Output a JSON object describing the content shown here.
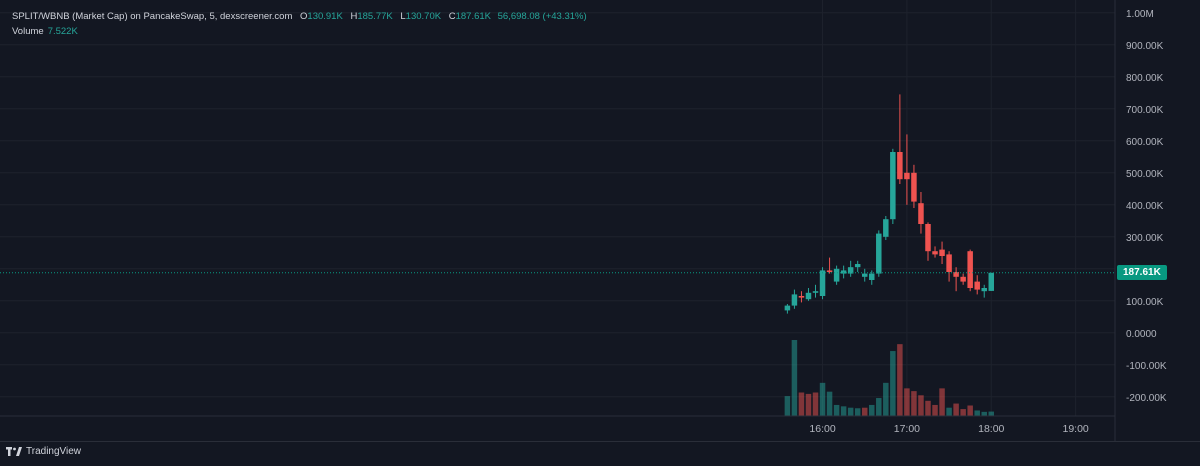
{
  "legend": {
    "symbol": "SPLIT/WBNB (Market Cap) on PancakeSwap, 5, dexscreener.com",
    "o_label": "O",
    "o_value": "130.91K",
    "h_label": "H",
    "h_value": "185.77K",
    "l_label": "L",
    "l_value": "130.70K",
    "c_label": "C",
    "c_value": "187.61K",
    "change": "56,698.08 (+43.31%)"
  },
  "volume": {
    "label": "Volume",
    "value": "7.522K"
  },
  "last_price_label": "187.61K",
  "brand": "TradingView",
  "colors": {
    "up": "#26a69a",
    "down": "#ef5350",
    "bg": "#131722",
    "grid": "#1e222d",
    "price_box": "#089981"
  },
  "chart_data": {
    "type": "candlestick",
    "y_ticks": [
      "1.00M",
      "900.00K",
      "800.00K",
      "700.00K",
      "600.00K",
      "500.00K",
      "400.00K",
      "300.00K",
      "200.00K",
      "100.00K",
      "0.0000",
      "-100.00K",
      "-200.00K"
    ],
    "y_tick_values": [
      1000,
      900,
      800,
      700,
      600,
      500,
      400,
      300,
      200,
      100,
      0,
      -100,
      -200
    ],
    "ylim": [
      -260,
      1040
    ],
    "x_ticks": [
      "16:00",
      "17:00",
      "18:00",
      "19:00"
    ],
    "x_tick_minutes": [
      960,
      1020,
      1080,
      1140
    ],
    "xlim": [
      375,
      1168
    ],
    "last_price": 187.61,
    "ohlc_unit": "K",
    "candles": [
      {
        "t": 935,
        "o": 70,
        "h": 90,
        "l": 60,
        "c": 85
      },
      {
        "t": 940,
        "o": 85,
        "h": 135,
        "l": 75,
        "c": 120
      },
      {
        "t": 945,
        "o": 115,
        "h": 130,
        "l": 95,
        "c": 110
      },
      {
        "t": 950,
        "o": 105,
        "h": 140,
        "l": 100,
        "c": 125
      },
      {
        "t": 955,
        "o": 125,
        "h": 150,
        "l": 110,
        "c": 130
      },
      {
        "t": 960,
        "o": 115,
        "h": 205,
        "l": 105,
        "c": 195
      },
      {
        "t": 965,
        "o": 195,
        "h": 235,
        "l": 185,
        "c": 190
      },
      {
        "t": 970,
        "o": 160,
        "h": 210,
        "l": 150,
        "c": 200
      },
      {
        "t": 975,
        "o": 185,
        "h": 210,
        "l": 170,
        "c": 195
      },
      {
        "t": 980,
        "o": 185,
        "h": 225,
        "l": 175,
        "c": 205
      },
      {
        "t": 985,
        "o": 205,
        "h": 225,
        "l": 190,
        "c": 215
      },
      {
        "t": 990,
        "o": 175,
        "h": 200,
        "l": 160,
        "c": 185
      },
      {
        "t": 995,
        "o": 165,
        "h": 195,
        "l": 150,
        "c": 185
      },
      {
        "t": 1000,
        "o": 185,
        "h": 320,
        "l": 175,
        "c": 310
      },
      {
        "t": 1005,
        "o": 300,
        "h": 365,
        "l": 290,
        "c": 355
      },
      {
        "t": 1010,
        "o": 355,
        "h": 575,
        "l": 340,
        "c": 565
      },
      {
        "t": 1015,
        "o": 565,
        "h": 745,
        "l": 465,
        "c": 480
      },
      {
        "t": 1020,
        "o": 500,
        "h": 620,
        "l": 400,
        "c": 480
      },
      {
        "t": 1025,
        "o": 500,
        "h": 525,
        "l": 390,
        "c": 410
      },
      {
        "t": 1030,
        "o": 405,
        "h": 440,
        "l": 310,
        "c": 340
      },
      {
        "t": 1035,
        "o": 340,
        "h": 345,
        "l": 225,
        "c": 255
      },
      {
        "t": 1040,
        "o": 255,
        "h": 270,
        "l": 235,
        "c": 245
      },
      {
        "t": 1045,
        "o": 260,
        "h": 285,
        "l": 215,
        "c": 240
      },
      {
        "t": 1050,
        "o": 245,
        "h": 255,
        "l": 160,
        "c": 190
      },
      {
        "t": 1055,
        "o": 190,
        "h": 205,
        "l": 130,
        "c": 175
      },
      {
        "t": 1060,
        "o": 175,
        "h": 185,
        "l": 150,
        "c": 160
      },
      {
        "t": 1065,
        "o": 255,
        "h": 260,
        "l": 130,
        "c": 140
      },
      {
        "t": 1070,
        "o": 160,
        "h": 180,
        "l": 120,
        "c": 135
      },
      {
        "t": 1075,
        "o": 130,
        "h": 150,
        "l": 110,
        "c": 140
      },
      {
        "t": 1080,
        "o": 130.91,
        "h": 185.77,
        "l": 130.7,
        "c": 187.61
      }
    ],
    "volumes": [
      {
        "t": 935,
        "v": 72,
        "up": true
      },
      {
        "t": 940,
        "v": 275,
        "up": true
      },
      {
        "t": 945,
        "v": 85,
        "up": false
      },
      {
        "t": 950,
        "v": 80,
        "up": false
      },
      {
        "t": 955,
        "v": 85,
        "up": false
      },
      {
        "t": 960,
        "v": 120,
        "up": true
      },
      {
        "t": 965,
        "v": 88,
        "up": true
      },
      {
        "t": 970,
        "v": 40,
        "up": true
      },
      {
        "t": 975,
        "v": 35,
        "up": true
      },
      {
        "t": 980,
        "v": 30,
        "up": true
      },
      {
        "t": 985,
        "v": 28,
        "up": true
      },
      {
        "t": 990,
        "v": 30,
        "up": false
      },
      {
        "t": 995,
        "v": 40,
        "up": true
      },
      {
        "t": 1000,
        "v": 65,
        "up": true
      },
      {
        "t": 1005,
        "v": 120,
        "up": true
      },
      {
        "t": 1010,
        "v": 235,
        "up": true
      },
      {
        "t": 1015,
        "v": 260,
        "up": false
      },
      {
        "t": 1020,
        "v": 100,
        "up": false
      },
      {
        "t": 1025,
        "v": 90,
        "up": false
      },
      {
        "t": 1030,
        "v": 75,
        "up": false
      },
      {
        "t": 1035,
        "v": 55,
        "up": false
      },
      {
        "t": 1040,
        "v": 40,
        "up": false
      },
      {
        "t": 1045,
        "v": 100,
        "up": false
      },
      {
        "t": 1050,
        "v": 30,
        "up": true
      },
      {
        "t": 1055,
        "v": 45,
        "up": false
      },
      {
        "t": 1060,
        "v": 25,
        "up": false
      },
      {
        "t": 1065,
        "v": 38,
        "up": false
      },
      {
        "t": 1070,
        "v": 20,
        "up": true
      },
      {
        "t": 1075,
        "v": 15,
        "up": true
      },
      {
        "t": 1080,
        "v": 16,
        "up": true
      }
    ]
  }
}
